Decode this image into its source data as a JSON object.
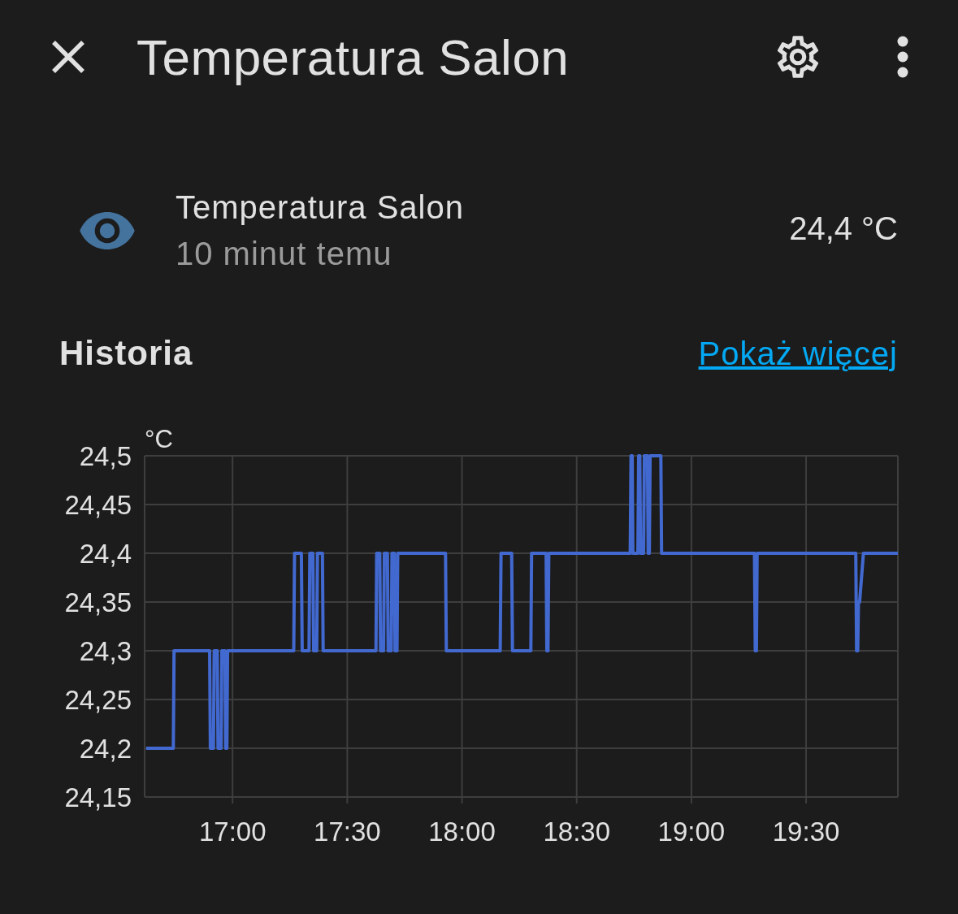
{
  "header": {
    "title": "Temperatura Salon"
  },
  "entity": {
    "name": "Temperatura Salon",
    "last_changed": "10 minut temu",
    "state": "24,4 °C"
  },
  "history": {
    "title": "Historia",
    "link": "Pokaż więcej",
    "chart_data": {
      "type": "line",
      "ylabel": "°C",
      "grid": true,
      "xlim": [
        16.6167,
        19.9
      ],
      "ylim": [
        24.15,
        24.5
      ],
      "xticks": [
        {
          "value": 17,
          "label": "17:00"
        },
        {
          "value": 17.5,
          "label": "17:30"
        },
        {
          "value": 18,
          "label": "18:00"
        },
        {
          "value": 18.5,
          "label": "18:30"
        },
        {
          "value": 19,
          "label": "19:00"
        },
        {
          "value": 19.5,
          "label": "19:30"
        }
      ],
      "yticks": [
        {
          "value": 24.5,
          "label": "24,5"
        },
        {
          "value": 24.45,
          "label": "24,45"
        },
        {
          "value": 24.4,
          "label": "24,4"
        },
        {
          "value": 24.35,
          "label": "24,35"
        },
        {
          "value": 24.3,
          "label": "24,3"
        },
        {
          "value": 24.25,
          "label": "24,25"
        },
        {
          "value": 24.2,
          "label": "24,2"
        },
        {
          "value": 24.15,
          "label": "24,15"
        }
      ],
      "x": [
        16.6233,
        16.7417,
        16.745,
        16.9,
        16.9033,
        16.9167,
        16.92,
        16.9333,
        16.9367,
        16.95,
        16.9533,
        16.9667,
        16.97,
        16.975,
        16.9783,
        17.2667,
        17.27,
        17.3,
        17.3033,
        17.3333,
        17.3367,
        17.35,
        17.3533,
        17.3667,
        17.37,
        17.3917,
        17.395,
        17.625,
        17.6283,
        17.6417,
        17.645,
        17.6583,
        17.6617,
        17.675,
        17.6783,
        17.6917,
        17.695,
        17.705,
        17.7083,
        17.7167,
        17.72,
        17.9283,
        17.9317,
        18.1667,
        18.17,
        18.2167,
        18.22,
        18.3,
        18.3033,
        18.3667,
        18.37,
        18.375,
        18.3783,
        18.7333,
        18.7367,
        18.7417,
        18.745,
        18.7667,
        18.77,
        18.775,
        18.7783,
        18.7917,
        18.795,
        18.8083,
        18.8117,
        18.8167,
        18.82,
        18.8667,
        18.87,
        19.275,
        19.2783,
        19.2833,
        19.2867,
        19.7167,
        19.72,
        19.725,
        19.7283,
        19.7333,
        19.75,
        19.9
      ],
      "series": [
        {
          "color": "#4269d0",
          "values": [
            24.2,
            24.2,
            24.3,
            24.3,
            24.2,
            24.2,
            24.3,
            24.3,
            24.2,
            24.2,
            24.3,
            24.3,
            24.2,
            24.2,
            24.3,
            24.3,
            24.4,
            24.4,
            24.3,
            24.3,
            24.4,
            24.4,
            24.3,
            24.3,
            24.4,
            24.4,
            24.3,
            24.3,
            24.4,
            24.4,
            24.3,
            24.3,
            24.4,
            24.4,
            24.3,
            24.3,
            24.4,
            24.4,
            24.3,
            24.3,
            24.4,
            24.4,
            24.3,
            24.3,
            24.4,
            24.4,
            24.3,
            24.3,
            24.4,
            24.4,
            24.3,
            24.3,
            24.4,
            24.4,
            24.5,
            24.5,
            24.4,
            24.4,
            24.5,
            24.5,
            24.4,
            24.4,
            24.5,
            24.5,
            24.4,
            24.4,
            24.5,
            24.5,
            24.4,
            24.4,
            24.3,
            24.3,
            24.4,
            24.4,
            24.3,
            24.3,
            24.35,
            24.35,
            24.4,
            24.4
          ]
        }
      ]
    }
  }
}
